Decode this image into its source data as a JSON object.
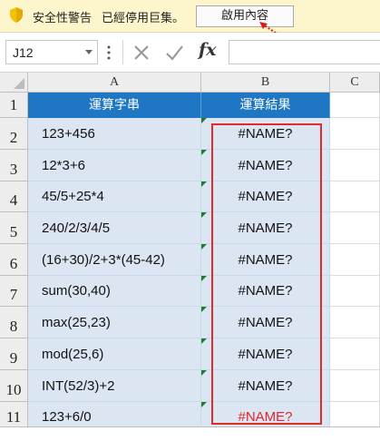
{
  "security_bar": {
    "title": "安全性警告",
    "message": "已經停用巨集。",
    "enable_button": "啟用內容"
  },
  "formula_bar": {
    "name_box": "J12",
    "fx_label": "fx",
    "formula": ""
  },
  "columns": [
    "A",
    "B",
    "C"
  ],
  "rows": [
    "1",
    "2",
    "3",
    "4",
    "5",
    "6",
    "7",
    "8",
    "9",
    "10",
    "11"
  ],
  "table": {
    "header_a": "運算字串",
    "header_b": "運算結果",
    "expressions": [
      "123+456",
      "12*3+6",
      "45/5+25*4",
      "240/2/3/4/5",
      "(16+30)/2+3*(45-42)",
      "sum(30,40)",
      "max(25,23)",
      "mod(25,6)",
      "INT(52/3)+2",
      "123+6/0"
    ],
    "results": [
      "#NAME?",
      "#NAME?",
      "#NAME?",
      "#NAME?",
      "#NAME?",
      "#NAME?",
      "#NAME?",
      "#NAME?",
      "#NAME?",
      "#NAME?"
    ]
  },
  "colors": {
    "header_fill": "#1f77c3",
    "cell_fill": "#dce6f2",
    "highlight_box": "#e02b2b",
    "last_error_text": "#e0262b"
  }
}
